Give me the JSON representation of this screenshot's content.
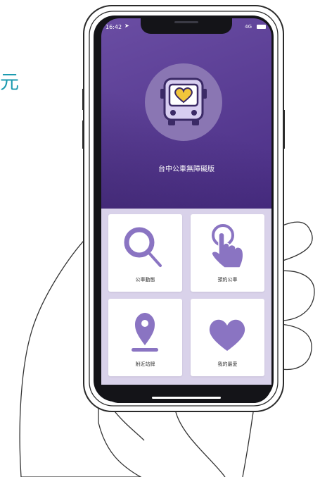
{
  "side_text": "元",
  "status_bar": {
    "time": "16:42",
    "location_icon": "location-arrow-icon",
    "signal": "4G",
    "battery_icon": "battery-icon"
  },
  "app": {
    "title": "台中公車無障礙版",
    "logo_icon": "bus-heart-icon"
  },
  "menu": [
    {
      "label": "公車動態",
      "icon": "magnifier-icon"
    },
    {
      "label": "預約公車",
      "icon": "tap-finger-icon"
    },
    {
      "label": "附近站牌",
      "icon": "map-pin-icon"
    },
    {
      "label": "我的最愛",
      "icon": "heart-icon"
    }
  ],
  "colors": {
    "accent_purple": "#5a3d96",
    "tile_icon": "#8a74c2",
    "heart_yellow": "#f1c53b",
    "side_text": "#1c9bb0"
  }
}
